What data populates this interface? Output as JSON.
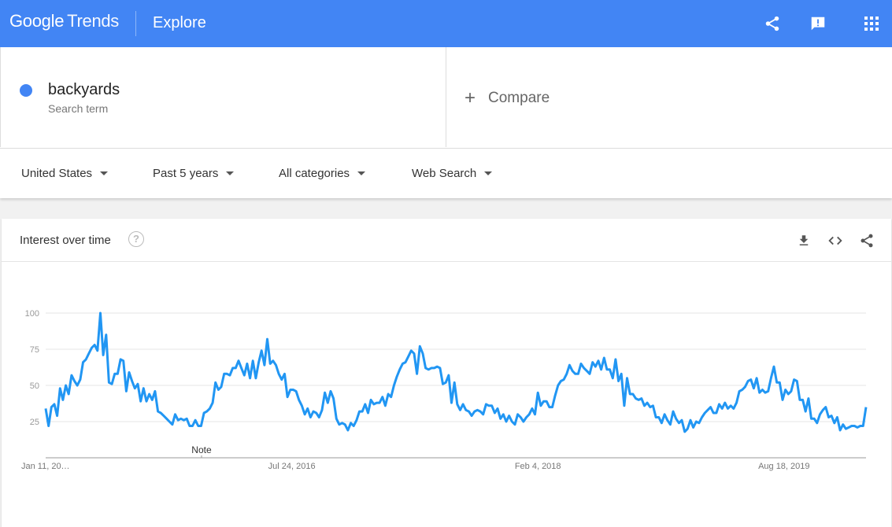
{
  "header": {
    "logo_google": "Google",
    "logo_trends": "Trends",
    "nav_title": "Explore",
    "icons": [
      "share-icon",
      "feedback-icon",
      "apps-icon"
    ]
  },
  "search": {
    "term": "backyards",
    "term_sub": "Search term",
    "term_color": "#4285f4",
    "compare_label": "Compare"
  },
  "filters": {
    "region": "United States",
    "period": "Past 5 years",
    "category": "All categories",
    "search_type": "Web Search"
  },
  "card": {
    "title": "Interest over time",
    "help_glyph": "?",
    "icons": [
      "download-icon",
      "embed-icon",
      "share-icon"
    ]
  },
  "chart_data": {
    "type": "line",
    "title": "Interest over time",
    "y_ticks": [
      25,
      50,
      75,
      100
    ],
    "ylim": [
      0,
      100
    ],
    "x_tick_labels": [
      "Jan 11, 20…",
      "Jul 24, 2016",
      "Feb 4, 2018",
      "Aug 18, 2019"
    ],
    "x_tick_positions": [
      0,
      0.3,
      0.6,
      0.9
    ],
    "annotation": "Note",
    "annotation_position": 0.19,
    "series": [
      {
        "color": "#2196f3",
        "values": [
          34,
          22,
          35,
          37,
          29,
          48,
          40,
          50,
          44,
          57,
          53,
          50,
          54,
          66,
          68,
          72,
          76,
          78,
          74,
          100,
          71,
          85,
          52,
          51,
          58,
          58,
          68,
          67,
          46,
          59,
          53,
          48,
          51,
          39,
          48,
          39,
          44,
          40,
          46,
          32,
          31,
          29,
          27,
          25,
          23,
          30,
          26,
          27,
          26,
          27,
          22,
          22,
          26,
          22,
          22,
          31,
          32,
          34,
          38,
          52,
          47,
          49,
          58,
          58,
          57,
          62,
          62,
          67,
          62,
          57,
          65,
          55,
          67,
          55,
          66,
          74,
          64,
          82,
          65,
          67,
          64,
          58,
          54,
          58,
          42,
          47,
          47,
          46,
          40,
          36,
          30,
          34,
          28,
          32,
          31,
          28,
          33,
          45,
          38,
          46,
          41,
          27,
          23,
          24,
          23,
          19,
          24,
          22,
          26,
          32,
          32,
          37,
          31,
          40,
          37,
          38,
          38,
          42,
          36,
          44,
          42,
          50,
          56,
          61,
          65,
          66,
          70,
          74,
          72,
          58,
          77,
          72,
          62,
          61,
          62,
          62,
          63,
          62,
          51,
          52,
          57,
          38,
          52,
          37,
          33,
          37,
          33,
          32,
          29,
          32,
          33,
          32,
          30,
          37,
          36,
          36,
          31,
          34,
          27,
          30,
          25,
          29,
          25,
          23,
          30,
          28,
          25,
          28,
          30,
          34,
          30,
          45,
          36,
          39,
          39,
          35,
          35,
          43,
          50,
          53,
          54,
          58,
          64,
          60,
          58,
          58,
          65,
          62,
          60,
          58,
          66,
          63,
          67,
          61,
          69,
          61,
          61,
          55,
          68,
          53,
          58,
          36,
          55,
          44,
          44,
          41,
          40,
          41,
          36,
          38,
          35,
          36,
          28,
          28,
          24,
          30,
          26,
          23,
          32,
          27,
          24,
          26,
          18,
          20,
          26,
          21,
          25,
          24,
          28,
          31,
          33,
          35,
          31,
          31,
          37,
          34,
          38,
          34,
          36,
          34,
          38,
          46,
          47,
          49,
          53,
          54,
          48,
          55,
          45,
          47,
          45,
          46,
          55,
          63,
          52,
          52,
          40,
          47,
          44,
          46,
          54,
          53,
          40,
          40,
          32,
          41,
          27,
          27,
          24,
          30,
          33,
          35,
          28,
          29,
          24,
          28,
          19,
          23,
          20,
          21,
          22,
          22,
          21,
          22,
          22,
          35
        ]
      }
    ]
  }
}
